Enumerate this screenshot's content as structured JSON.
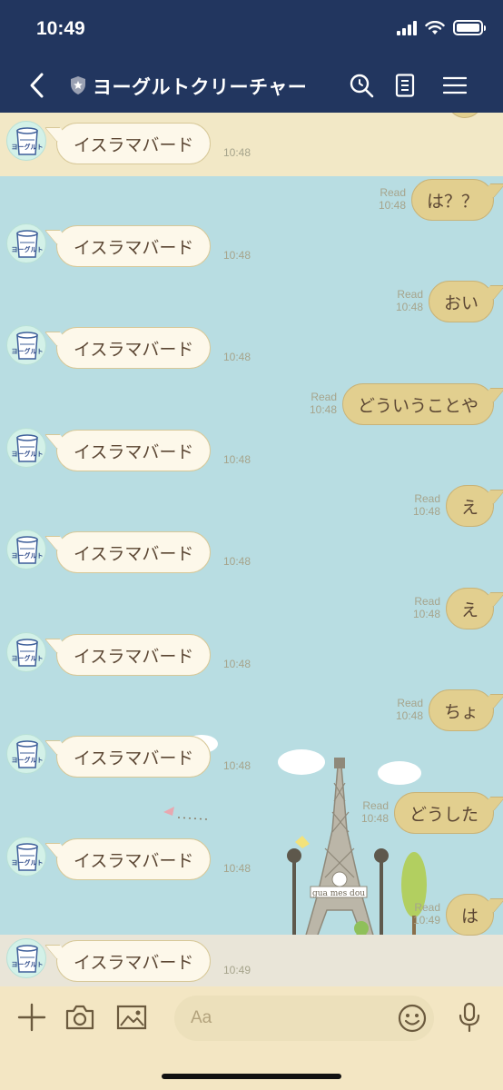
{
  "status": {
    "time": "10:49"
  },
  "header": {
    "title": "ヨーグルトクリーチャー"
  },
  "input": {
    "placeholder": "Aa"
  },
  "messages": {
    "left_text": "イスラマバード",
    "left_times": [
      "10:48",
      "10:48",
      "10:48",
      "10:48",
      "10:48",
      "10:48",
      "10:48",
      "10:48",
      "10:49"
    ],
    "right": [
      {
        "text": "は？？",
        "read": "Read",
        "time": "10:48"
      },
      {
        "text": "おい",
        "read": "Read",
        "time": "10:48"
      },
      {
        "text": "どういうことや",
        "read": "Read",
        "time": "10:48"
      },
      {
        "text": "え",
        "read": "Read",
        "time": "10:48"
      },
      {
        "text": "え",
        "read": "Read",
        "time": "10:48"
      },
      {
        "text": "ちょ",
        "read": "Read",
        "time": "10:48"
      },
      {
        "text": "どうした",
        "read": "Read",
        "time": "10:48"
      },
      {
        "text": "は",
        "read": "Read",
        "time": "10:49"
      }
    ]
  },
  "avatar_label": "ヨーグルト",
  "background_sign": "gua mes dou",
  "colors": {
    "header": "#22365f",
    "chat_bg": "#b8dde2",
    "bubble_right": "#e2cf8f",
    "bubble_left": "#fdf8ea",
    "bottom": "#f3e6c3"
  }
}
